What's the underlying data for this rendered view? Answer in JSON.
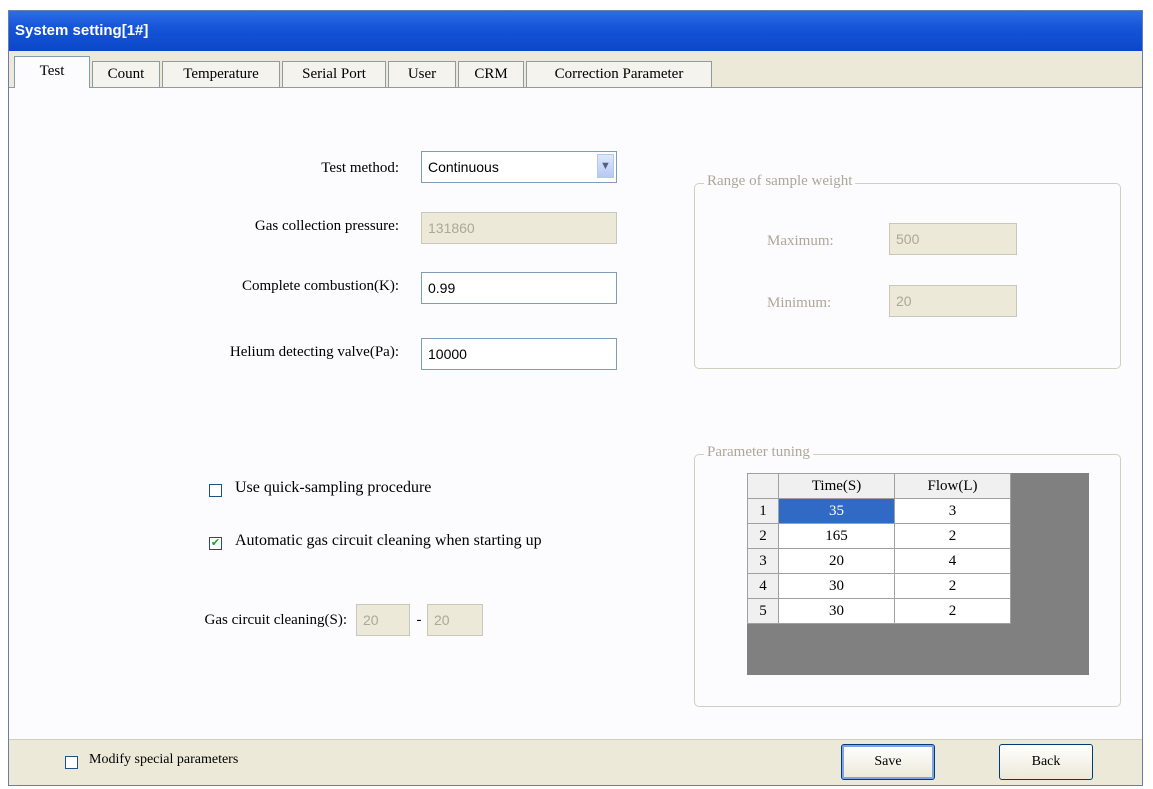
{
  "window": {
    "title": "System setting[1#]"
  },
  "tabs": [
    {
      "label": "Test",
      "active": true
    },
    {
      "label": "Count"
    },
    {
      "label": "Temperature"
    },
    {
      "label": "Serial Port"
    },
    {
      "label": "User"
    },
    {
      "label": "CRM"
    },
    {
      "label": "Correction Parameter"
    }
  ],
  "form": {
    "test_method": {
      "label": "Test method:",
      "value": "Continuous"
    },
    "gas_pressure": {
      "label": "Gas collection pressure:",
      "value": "131860"
    },
    "complete_combustion": {
      "label": "Complete combustion(K):",
      "value": "0.99"
    },
    "helium_valve": {
      "label": "Helium detecting valve(Pa):",
      "value": "10000"
    },
    "quick_sampling": {
      "label": "Use quick-sampling procedure",
      "checked": false
    },
    "auto_cleaning": {
      "label": "Automatic gas circuit cleaning when starting up",
      "checked": true
    },
    "gas_cleaning": {
      "label": "Gas circuit cleaning(S):",
      "from": "20",
      "separator": "-",
      "to": "20"
    }
  },
  "sample_range": {
    "title": "Range of sample weight",
    "maximum_label": "Maximum:",
    "maximum_value": "500",
    "minimum_label": "Minimum:",
    "minimum_value": "20"
  },
  "tuning": {
    "title": "Parameter tuning",
    "columns": [
      "Time(S)",
      "Flow(L)"
    ],
    "rows": [
      {
        "index": "1",
        "time": "35",
        "flow": "3"
      },
      {
        "index": "2",
        "time": "165",
        "flow": "2"
      },
      {
        "index": "3",
        "time": "20",
        "flow": "4"
      },
      {
        "index": "4",
        "time": "30",
        "flow": "2"
      },
      {
        "index": "5",
        "time": "30",
        "flow": "2"
      }
    ]
  },
  "footer": {
    "modify_special": {
      "label": "Modify special parameters",
      "checked": false
    },
    "save_label": "Save",
    "back_label": "Back"
  },
  "colors": {
    "title_bar": "#0b47c8",
    "selection": "#316ac5",
    "check": "#21a121"
  },
  "icons": {
    "dropdown": "chevron-down-icon",
    "check": "check-icon"
  }
}
